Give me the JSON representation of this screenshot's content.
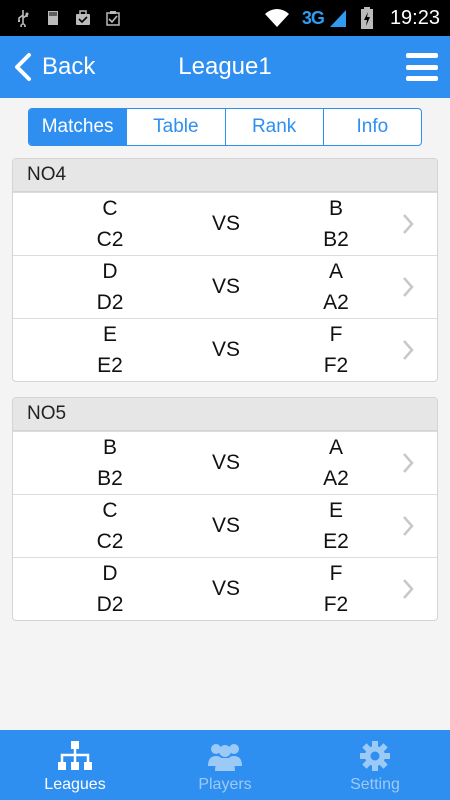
{
  "status_bar": {
    "time": "19:23",
    "network": "3G",
    "icons_left": [
      "usb-icon",
      "sd-card-icon",
      "briefcase-icon",
      "clipboard-check-icon"
    ],
    "icons_right": [
      "wifi-icon",
      "signal-icon",
      "battery-charging-icon"
    ]
  },
  "header": {
    "back_label": "Back",
    "title": "League1"
  },
  "tabs": [
    {
      "label": "Matches",
      "active": true
    },
    {
      "label": "Table",
      "active": false
    },
    {
      "label": "Rank",
      "active": false
    },
    {
      "label": "Info",
      "active": false
    }
  ],
  "rounds": [
    {
      "name": "NO4",
      "matches": [
        {
          "home": "C",
          "home_player": "C2",
          "vs": "VS",
          "away": "B",
          "away_player": "B2"
        },
        {
          "home": "D",
          "home_player": "D2",
          "vs": "VS",
          "away": "A",
          "away_player": "A2"
        },
        {
          "home": "E",
          "home_player": "E2",
          "vs": "VS",
          "away": "F",
          "away_player": "F2"
        }
      ]
    },
    {
      "name": "NO5",
      "matches": [
        {
          "home": "B",
          "home_player": "B2",
          "vs": "VS",
          "away": "A",
          "away_player": "A2"
        },
        {
          "home": "C",
          "home_player": "C2",
          "vs": "VS",
          "away": "E",
          "away_player": "E2"
        },
        {
          "home": "D",
          "home_player": "D2",
          "vs": "VS",
          "away": "F",
          "away_player": "F2"
        }
      ]
    }
  ],
  "bottom_nav": [
    {
      "label": "Leagues",
      "icon": "hierarchy-icon",
      "active": true
    },
    {
      "label": "Players",
      "icon": "players-group-icon",
      "active": false
    },
    {
      "label": "Setting",
      "icon": "gear-icon",
      "active": false
    }
  ],
  "colors": {
    "primary": "#2e8ff0",
    "inactive_nav": "#9ccaf6",
    "round_header_bg": "#e6e6e6"
  }
}
